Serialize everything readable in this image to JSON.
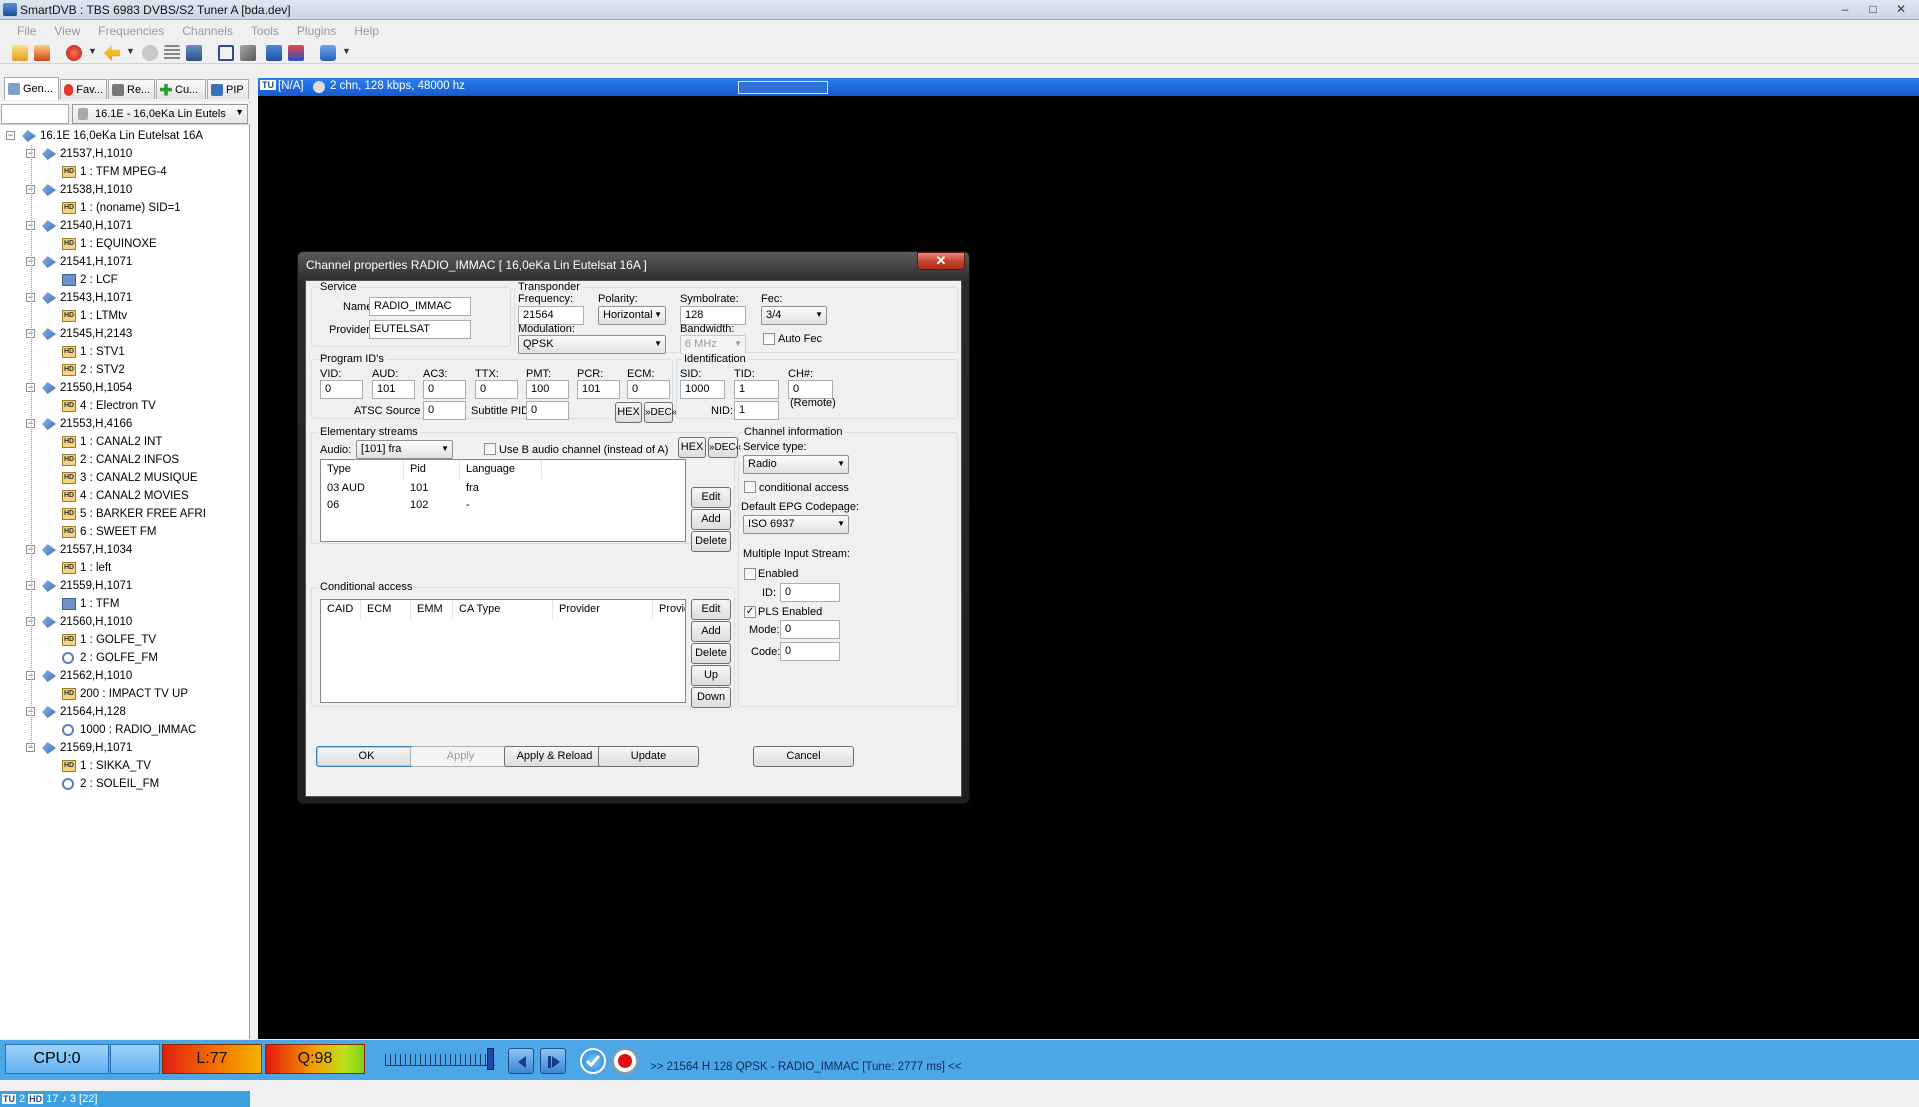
{
  "window": {
    "title": "SmartDVB : TBS 6983 DVBS/S2 Tuner A [bda.dev]",
    "min": "‒",
    "max": "□",
    "close": "✕"
  },
  "menu": [
    "File",
    "View",
    "Frequencies",
    "Channels",
    "Tools",
    "Plugins",
    "Help"
  ],
  "tabs": [
    "Gen...",
    "Fav...",
    "Re...",
    "Cu...",
    "PIP"
  ],
  "satellite_select": "16.1E - 16,0eKa Lin Eutels",
  "tree": {
    "root": "16.1E  16,0eKa Lin Eutelsat 16A",
    "transponders": [
      {
        "label": "21537,H,1010",
        "channels": [
          {
            "label": "1 : TFM MPEG-4",
            "icon": "hd"
          }
        ]
      },
      {
        "label": "21538,H,1010",
        "channels": [
          {
            "label": "1 : (noname) SID=1",
            "icon": "hd"
          }
        ]
      },
      {
        "label": "21540,H,1071",
        "channels": [
          {
            "label": "1 : EQUINOXE",
            "icon": "hd"
          }
        ]
      },
      {
        "label": "21541,H,1071",
        "channels": [
          {
            "label": "2 : LCF",
            "icon": "tv"
          }
        ]
      },
      {
        "label": "21543,H,1071",
        "channels": [
          {
            "label": "1 : LTMtv",
            "icon": "hd"
          }
        ]
      },
      {
        "label": "21545,H,2143",
        "channels": [
          {
            "label": "1 : STV1",
            "icon": "hd"
          },
          {
            "label": "2 : STV2",
            "icon": "hd"
          }
        ]
      },
      {
        "label": "21550,H,1054",
        "channels": [
          {
            "label": "4 : Electron TV",
            "icon": "hd"
          }
        ]
      },
      {
        "label": "21553,H,4166",
        "channels": [
          {
            "label": "1 : CANAL2 INT",
            "icon": "hd"
          },
          {
            "label": "2 : CANAL2 INFOS",
            "icon": "hd"
          },
          {
            "label": "3 : CANAL2 MUSIQUE",
            "icon": "hd"
          },
          {
            "label": "4 : CANAL2 MOVIES",
            "icon": "hd"
          },
          {
            "label": "5 : BARKER FREE AFRI",
            "icon": "hd"
          },
          {
            "label": "6 : SWEET FM",
            "icon": "hd"
          }
        ]
      },
      {
        "label": "21557,H,1034",
        "channels": [
          {
            "label": "1 : left",
            "icon": "hd"
          }
        ]
      },
      {
        "label": "21559,H,1071",
        "channels": [
          {
            "label": "1 : TFM",
            "icon": "tv"
          }
        ]
      },
      {
        "label": "21560,H,1010",
        "channels": [
          {
            "label": "1 : GOLFE_TV",
            "icon": "hd"
          },
          {
            "label": "2 : GOLFE_FM",
            "icon": "radio"
          }
        ]
      },
      {
        "label": "21562,H,1010",
        "channels": [
          {
            "label": "200 : IMPACT TV UP",
            "icon": "hd"
          }
        ]
      },
      {
        "label": "21564,H,128",
        "channels": [
          {
            "label": "1000 : RADIO_IMMAC",
            "icon": "radio"
          }
        ]
      },
      {
        "label": "21569,H,1071",
        "channels": [
          {
            "label": "1 : SIKKA_TV",
            "icon": "hd"
          },
          {
            "label": "2 : SOLEIL_FM",
            "icon": "radio"
          }
        ]
      }
    ]
  },
  "left_status": {
    "tu": "TU",
    "n1": "2",
    "hd": "HD",
    "n2": "17",
    "n3": "3 [22]"
  },
  "infobar": {
    "tu": "TU",
    "na": "[N/A]",
    "audio": "2 chn, 128 kbps, 48000 hz"
  },
  "bottom": {
    "cpu": "CPU:0",
    "level": "L:77",
    "quality": "Q:98",
    "status": "21564 H 128 QPSK - RADIO_IMMAC [Tune: 2777 ms]",
    "status_prefix": ">>",
    "status_suffix": "<<"
  },
  "dialog": {
    "title": "Channel properties RADIO_IMMAC [ 16,0eKa Lin Eutelsat 16A ]",
    "close": "✕",
    "service": {
      "group": "Service",
      "name_label": "Name:",
      "name": "RADIO_IMMAC",
      "provider_label": "Provider:",
      "provider": "EUTELSAT"
    },
    "transponder": {
      "group": "Transponder",
      "freq_label": "Frequency:",
      "freq": "21564",
      "pol_label": "Polarity:",
      "pol": "Horizontal",
      "sym_label": "Symbolrate:",
      "sym": "128",
      "fec_label": "Fec:",
      "fec": "3/4",
      "mod_label": "Modulation:",
      "mod": "QPSK",
      "bw_label": "Bandwidth:",
      "bw": "6 MHz",
      "autofec": "Auto Fec"
    },
    "pids": {
      "group": "Program ID's",
      "vid_l": "VID:",
      "vid": "0",
      "aud_l": "AUD:",
      "aud": "101",
      "ac3_l": "AC3:",
      "ac3": "0",
      "ttx_l": "TTX:",
      "ttx": "0",
      "pmt_l": "PMT:",
      "pmt": "100",
      "pcr_l": "PCR:",
      "pcr": "101",
      "ecm_l": "ECM:",
      "ecm": "0",
      "atsc_l": "ATSC Source ID:",
      "atsc": "0",
      "sub_l": "Subtitle PID:",
      "sub": "0",
      "hex": "HEX",
      "dec": "»DEC«"
    },
    "ident": {
      "group": "Identification",
      "sid_l": "SID:",
      "sid": "1000",
      "tid_l": "TID:",
      "tid": "1",
      "ch_l": "CH#:",
      "ch": "0",
      "remote": "(Remote)",
      "nid_l": "NID:",
      "nid": "1"
    },
    "es": {
      "group": "Elementary streams",
      "audio_l": "Audio:",
      "audio": "[101] fra",
      "useb": "Use B audio channel (instead of A)",
      "hex": "HEX",
      "dec": "»DEC«",
      "cols": [
        "Type",
        "Pid",
        "Language"
      ],
      "rows": [
        [
          "03 AUD",
          "101",
          "fra"
        ],
        [
          "06",
          "102",
          "-"
        ]
      ],
      "edit": "Edit",
      "add": "Add",
      "delete": "Delete"
    },
    "ca": {
      "group": "Conditional access",
      "cols": [
        "CAID",
        "ECM",
        "EMM",
        "CA Type",
        "Provider",
        "Provider"
      ],
      "edit": "Edit",
      "add": "Add",
      "delete": "Delete",
      "up": "Up",
      "down": "Down"
    },
    "chinfo": {
      "group": "Channel information",
      "stype_l": "Service type:",
      "stype": "Radio",
      "cond": "conditional access",
      "epg_l": "Default EPG Codepage:",
      "epg": "ISO 6937",
      "mis_l": "Multiple Input Stream:",
      "enabled": "Enabled",
      "id_l": "ID:",
      "id": "0",
      "pls": "PLS Enabled",
      "mode_l": "Mode:",
      "mode": "0",
      "code_l": "Code:",
      "code": "0"
    },
    "buttons": {
      "ok": "OK",
      "apply": "Apply",
      "apply_reload": "Apply & Reload",
      "update": "Update",
      "cancel": "Cancel"
    }
  },
  "colors": {
    "accent": "#1758d0",
    "video_bg": "#000000",
    "status_bg": "#4da6e5"
  }
}
